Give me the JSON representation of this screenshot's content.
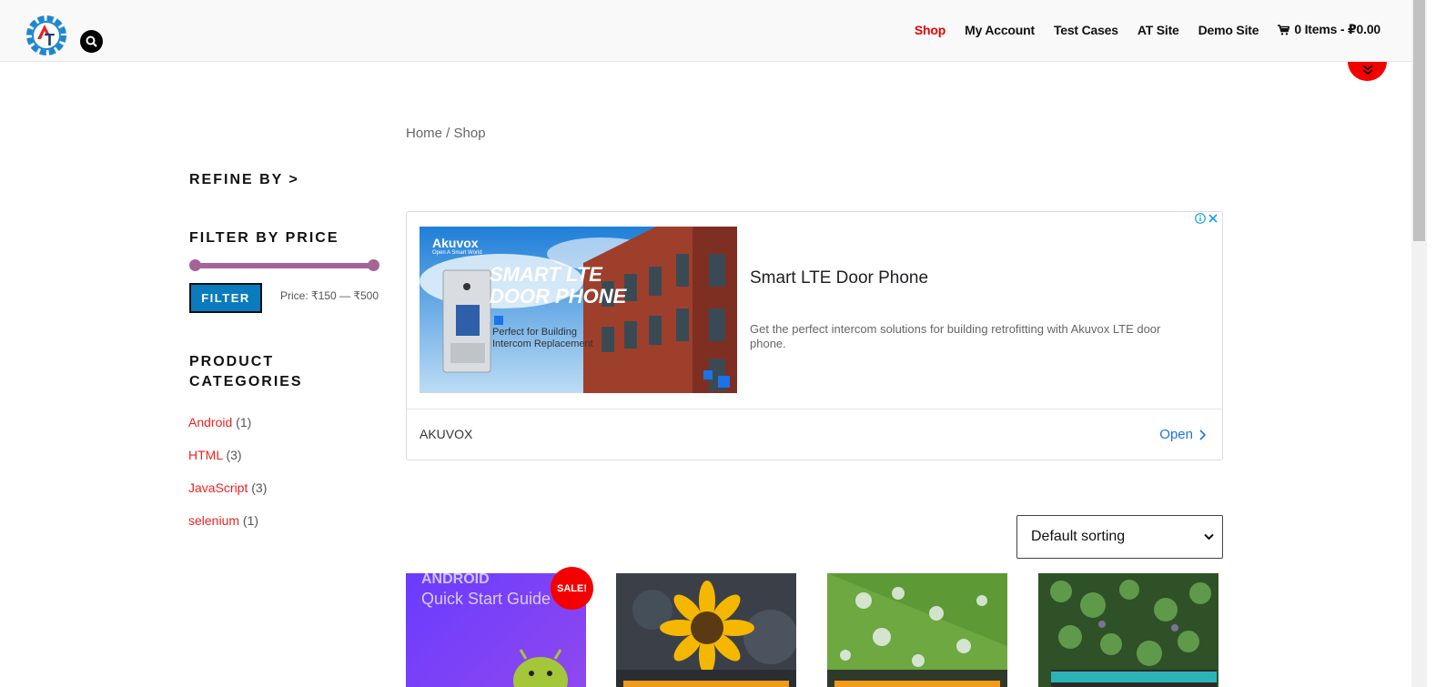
{
  "header": {
    "nav": [
      {
        "label": "Shop",
        "active": true
      },
      {
        "label": "My Account",
        "active": false
      },
      {
        "label": "Test Cases",
        "active": false
      },
      {
        "label": "AT Site",
        "active": false
      },
      {
        "label": "Demo Site",
        "active": false
      }
    ],
    "cart_label": "0 Items - ₽0.00",
    "logo_letters": "AT"
  },
  "breadcrumb": {
    "home": "Home",
    "separator": " / ",
    "current": "Shop"
  },
  "sidebar": {
    "refine_title": "REFINE BY >",
    "price_title": "FILTER BY PRICE",
    "filter_button": "FILTER",
    "price_range": "Price: ₹150 — ₹500",
    "categories_title": "PRODUCT CATEGORIES",
    "categories": [
      {
        "name": "Android",
        "count": "(1)"
      },
      {
        "name": "HTML",
        "count": "(3)"
      },
      {
        "name": "JavaScript",
        "count": "(3)"
      },
      {
        "name": "selenium",
        "count": "(1)"
      }
    ]
  },
  "ad": {
    "image_brand": "Akuvox",
    "image_tagline": "Open A Smart World",
    "image_headline_1": "SMART LTE",
    "image_headline_2": "DOOR PHONE",
    "image_sub_1": "Perfect for Building",
    "image_sub_2": "Intercom Replacement",
    "title": "Smart LTE Door Phone",
    "description": "Get the perfect intercom solutions for building retrofitting with Akuvox LTE door phone.",
    "brand": "AKUVOX",
    "open_label": "Open"
  },
  "sorting": {
    "selected": "Default sorting"
  },
  "products": [
    {
      "image_text_1": "ANDROID",
      "image_text_2": "Quick Start Guide",
      "sale": "SALE!"
    }
  ],
  "colors": {
    "accent_red": "#f40000",
    "slider": "#a46497",
    "filter_btn": "#0a7bbd",
    "link_red": "#e22222",
    "ad_link": "#1a73e8"
  }
}
